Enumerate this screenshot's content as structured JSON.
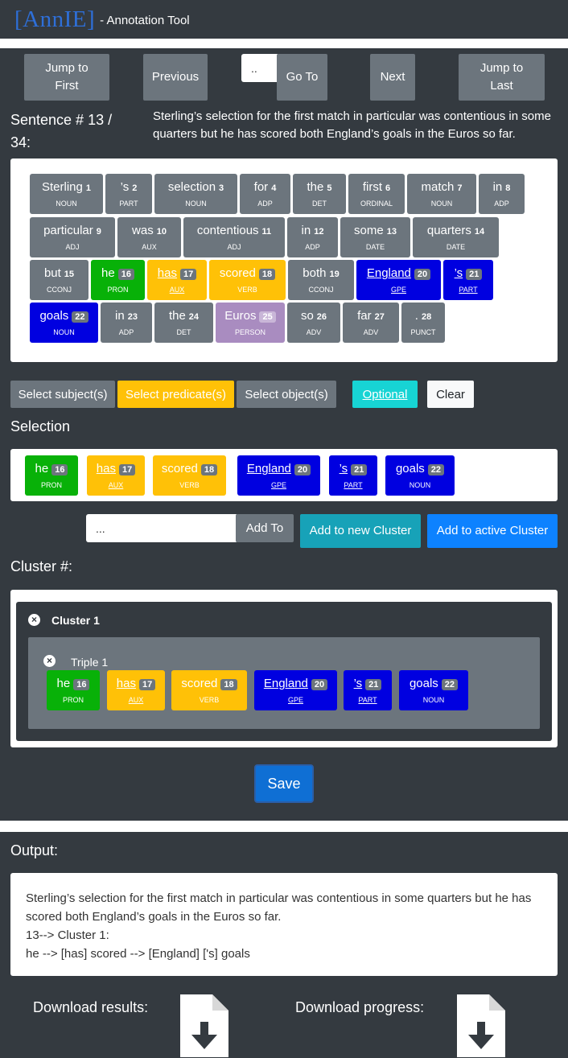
{
  "header": {
    "brand": "[AnnIE]",
    "subtitle": "- Annotation Tool"
  },
  "nav": {
    "jump_first": [
      "Jump to",
      "First"
    ],
    "previous": "Previous",
    "goto_placeholder": "..",
    "goto": "Go To",
    "next": "Next",
    "jump_last": [
      "Jump to",
      "Last"
    ]
  },
  "sentence": {
    "label": "Sentence # 13 / 34:",
    "text": "Sterling’s selection for the first match in particular was contentious in some quarters but he has scored both England’s goals in the Euros so far."
  },
  "tokens": [
    {
      "w": "Sterling",
      "n": "1",
      "t": "NOUN"
    },
    {
      "w": "’s",
      "n": "2",
      "t": "PART"
    },
    {
      "w": "selection",
      "n": "3",
      "t": "NOUN"
    },
    {
      "w": "for",
      "n": "4",
      "t": "ADP"
    },
    {
      "w": "the",
      "n": "5",
      "t": "DET"
    },
    {
      "w": "first",
      "n": "6",
      "t": "ORDINAL"
    },
    {
      "w": "match",
      "n": "7",
      "t": "NOUN"
    },
    {
      "w": "in",
      "n": "8",
      "t": "ADP"
    },
    {
      "w": "particular",
      "n": "9",
      "t": "ADJ"
    },
    {
      "w": "was",
      "n": "10",
      "t": "AUX"
    },
    {
      "w": "contentious",
      "n": "11",
      "t": "ADJ"
    },
    {
      "w": "in",
      "n": "12",
      "t": "ADP"
    },
    {
      "w": "some",
      "n": "13",
      "t": "DATE"
    },
    {
      "w": "quarters",
      "n": "14",
      "t": "DATE"
    },
    {
      "w": "but",
      "n": "15",
      "t": "CCONJ"
    },
    {
      "w": "he",
      "n": "16",
      "t": "PRON"
    },
    {
      "w": "has",
      "n": "17",
      "t": "AUX"
    },
    {
      "w": "scored",
      "n": "18",
      "t": "VERB"
    },
    {
      "w": "both",
      "n": "19",
      "t": "CCONJ"
    },
    {
      "w": "England",
      "n": "20",
      "t": "GPE"
    },
    {
      "w": "’s",
      "n": "21",
      "t": "PART"
    },
    {
      "w": "goals",
      "n": "22",
      "t": "NOUN"
    },
    {
      "w": "in",
      "n": "23",
      "t": "ADP"
    },
    {
      "w": "the",
      "n": "24",
      "t": "DET"
    },
    {
      "w": "Euros",
      "n": "25",
      "t": "PERSON"
    },
    {
      "w": "so",
      "n": "26",
      "t": "ADV"
    },
    {
      "w": "far",
      "n": "27",
      "t": "ADV"
    },
    {
      "w": ".",
      "n": "28",
      "t": "PUNCT"
    }
  ],
  "role_buttons": {
    "subject": "Select subject(s)",
    "predicate": "Select predicate(s)",
    "object": "Select object(s)",
    "optional": "Optional",
    "clear": "Clear"
  },
  "selection": {
    "label": "Selection",
    "tokens": [
      {
        "w": "he",
        "n": "16",
        "t": "PRON"
      },
      {
        "w": "has",
        "n": "17",
        "t": "AUX"
      },
      {
        "w": "scored",
        "n": "18",
        "t": "VERB"
      },
      {
        "w": "England",
        "n": "20",
        "t": "GPE"
      },
      {
        "w": "’s",
        "n": "21",
        "t": "PART"
      },
      {
        "w": "goals",
        "n": "22",
        "t": "NOUN"
      }
    ]
  },
  "add": {
    "placeholder": "...",
    "add_to": "Add To",
    "new_cluster": "Add to new Cluster",
    "active_cluster": "Add to active Cluster"
  },
  "cluster": {
    "label": "Cluster #:",
    "title": "Cluster 1",
    "triple_title": "Triple 1",
    "tokens": [
      {
        "w": "he",
        "n": "16",
        "t": "PRON"
      },
      {
        "w": "has",
        "n": "17",
        "t": "AUX"
      },
      {
        "w": "scored",
        "n": "18",
        "t": "VERB"
      },
      {
        "w": "England",
        "n": "20",
        "t": "GPE"
      },
      {
        "w": "’s",
        "n": "21",
        "t": "PART"
      },
      {
        "w": "goals",
        "n": "22",
        "t": "NOUN"
      }
    ]
  },
  "save": "Save",
  "output": {
    "label": "Output:",
    "lines": [
      "Sterling’s selection for the first match in particular was contentious in some quarters but he has scored both England’s goals in the Euros so far.",
      "13--> Cluster 1:",
      "he --> [has] scored --> [England] ['s] goals"
    ]
  },
  "downloads": {
    "results": "Download results:",
    "progress": "Download progress:"
  },
  "colors": {
    "panel": "#343a40",
    "grey": "#6c757d",
    "subject": "#08b108",
    "predicate": "#ffc107",
    "object": "#0000e0",
    "entity": "#a98cc0",
    "optional": "#17d4d4",
    "info": "#17a2b8",
    "primary": "#0d82ff"
  }
}
